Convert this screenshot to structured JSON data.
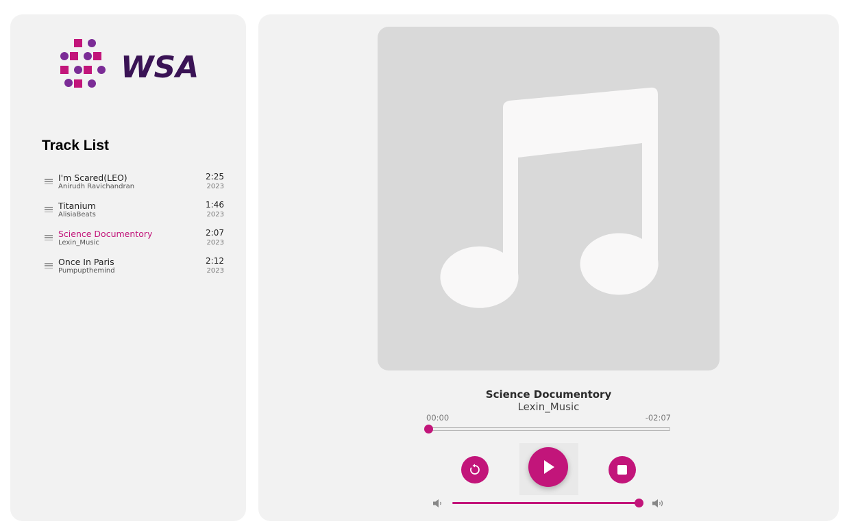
{
  "brand": {
    "name": "WSA",
    "accent": "#c2157a",
    "accent2": "#7b2c96",
    "text_color": "#3a1355"
  },
  "sidebar": {
    "heading": "Track List",
    "tracks": [
      {
        "title": "I'm Scared(LEO)",
        "artist": "Anirudh Ravichandran",
        "duration": "2:25",
        "year": "2023"
      },
      {
        "title": "Titanium",
        "artist": "AlisiaBeats",
        "duration": "1:46",
        "year": "2023"
      },
      {
        "title": "Science Documentory",
        "artist": "Lexin_Music",
        "duration": "2:07",
        "year": "2023"
      },
      {
        "title": "Once In Paris",
        "artist": "Pumpupthemind",
        "duration": "2:12",
        "year": "2023"
      }
    ],
    "active_track_index": 2
  },
  "player": {
    "album_art_icon": "music-note-icon",
    "now_playing_title": "Science Documentory",
    "now_playing_artist": "Lexin_Music",
    "time_elapsed": "00:00",
    "time_remaining": "-02:07",
    "progress_fraction": 0,
    "volume_fraction": 1,
    "controls": {
      "replay_icon": "replay-icon",
      "play_icon": "play-icon",
      "stop_icon": "stop-icon",
      "volume_low_icon": "volume-low-icon",
      "volume_high_icon": "volume-high-icon"
    }
  }
}
